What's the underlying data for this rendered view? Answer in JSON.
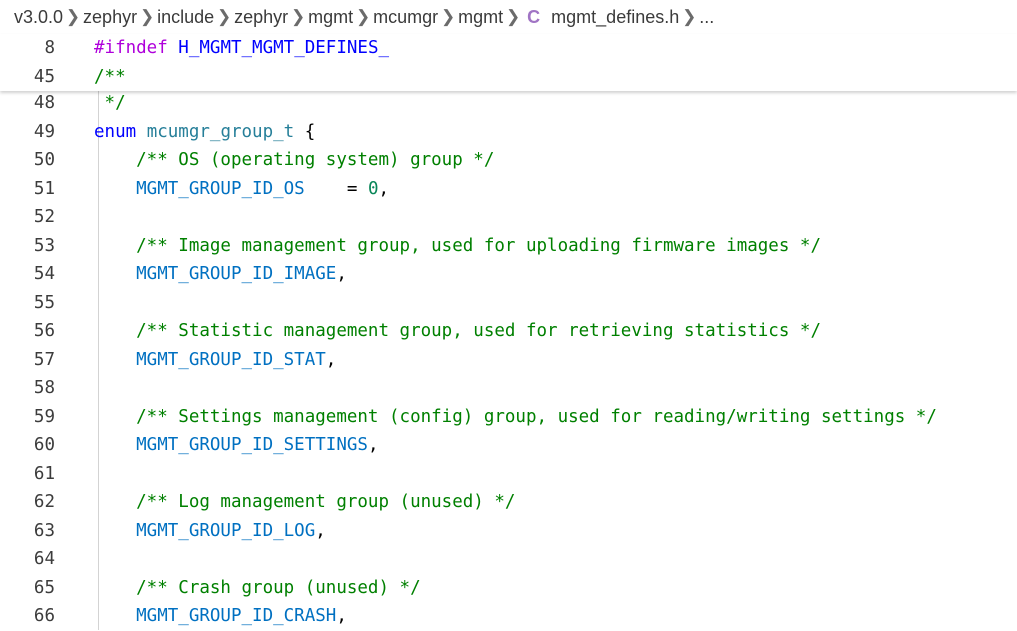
{
  "breadcrumb": {
    "items": [
      "v3.0.0",
      "zephyr",
      "include",
      "zephyr",
      "mgmt",
      "mcumgr",
      "mgmt"
    ],
    "file_icon": "C",
    "file": "mgmt_defines.h",
    "ellipsis": "..."
  },
  "sticky_lines": [
    {
      "num": "8",
      "parts": [
        {
          "t": "#ifndef ",
          "c": "kw-pre"
        },
        {
          "t": "H_MGMT_MGMT_DEFINES_",
          "c": "macro"
        }
      ]
    },
    {
      "num": "45",
      "parts": [
        {
          "t": "/**",
          "c": "comment"
        }
      ]
    }
  ],
  "lines": [
    {
      "num": "48",
      "parts": [
        {
          "t": " */",
          "c": "comment"
        }
      ]
    },
    {
      "num": "49",
      "parts": [
        {
          "t": "enum ",
          "c": "enum-kw"
        },
        {
          "t": "mcumgr_group_t",
          "c": "type"
        },
        {
          "t": " {",
          "c": "punct"
        }
      ]
    },
    {
      "num": "50",
      "parts": [
        {
          "t": "    /** OS (operating system) group */",
          "c": "comment"
        }
      ]
    },
    {
      "num": "51",
      "parts": [
        {
          "t": "    MGMT_GROUP_ID_OS",
          "c": "ident"
        },
        {
          "t": "    = ",
          "c": "punct"
        },
        {
          "t": "0",
          "c": "num"
        },
        {
          "t": ",",
          "c": "punct"
        }
      ]
    },
    {
      "num": "52",
      "parts": []
    },
    {
      "num": "53",
      "parts": [
        {
          "t": "    /** Image management group, used for uploading firmware images */",
          "c": "comment"
        }
      ]
    },
    {
      "num": "54",
      "parts": [
        {
          "t": "    MGMT_GROUP_ID_IMAGE",
          "c": "ident"
        },
        {
          "t": ",",
          "c": "punct"
        }
      ]
    },
    {
      "num": "55",
      "parts": []
    },
    {
      "num": "56",
      "parts": [
        {
          "t": "    /** Statistic management group, used for retrieving statistics */",
          "c": "comment"
        }
      ]
    },
    {
      "num": "57",
      "parts": [
        {
          "t": "    MGMT_GROUP_ID_STAT",
          "c": "ident"
        },
        {
          "t": ",",
          "c": "punct"
        }
      ]
    },
    {
      "num": "58",
      "parts": []
    },
    {
      "num": "59",
      "parts": [
        {
          "t": "    /** Settings management (config) group, used for reading/writing settings */",
          "c": "comment"
        }
      ]
    },
    {
      "num": "60",
      "parts": [
        {
          "t": "    MGMT_GROUP_ID_SETTINGS",
          "c": "ident"
        },
        {
          "t": ",",
          "c": "punct"
        }
      ]
    },
    {
      "num": "61",
      "parts": []
    },
    {
      "num": "62",
      "parts": [
        {
          "t": "    /** Log management group (unused) */",
          "c": "comment"
        }
      ]
    },
    {
      "num": "63",
      "parts": [
        {
          "t": "    MGMT_GROUP_ID_LOG",
          "c": "ident"
        },
        {
          "t": ",",
          "c": "punct"
        }
      ]
    },
    {
      "num": "64",
      "parts": []
    },
    {
      "num": "65",
      "parts": [
        {
          "t": "    /** Crash group (unused) */",
          "c": "comment"
        }
      ]
    },
    {
      "num": "66",
      "parts": [
        {
          "t": "    MGMT_GROUP_ID_CRASH",
          "c": "ident"
        },
        {
          "t": ",",
          "c": "punct"
        }
      ]
    }
  ]
}
